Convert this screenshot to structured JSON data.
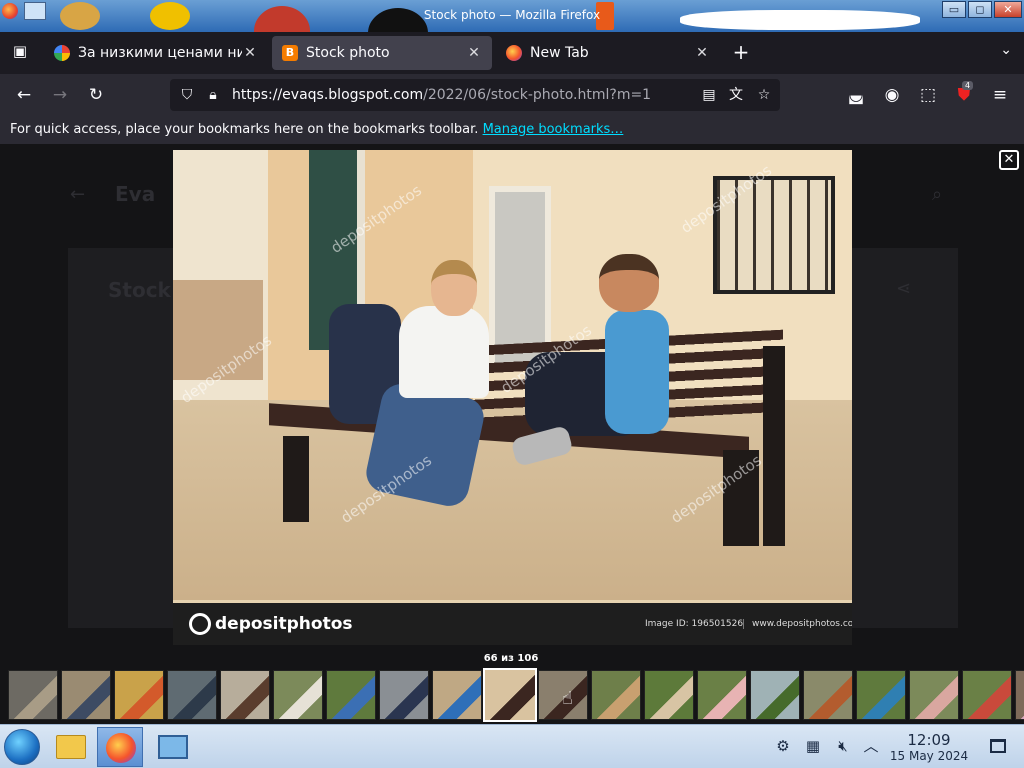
{
  "window": {
    "title": "Stock photo — Mozilla Firefox",
    "controls": {
      "minimize": "▭",
      "maximize": "◻",
      "close": "✕"
    }
  },
  "tabs": [
    {
      "title": "За низкими ценами ни",
      "favicon": "google-icon",
      "active": false
    },
    {
      "title": "Stock photo",
      "favicon": "blogger-icon",
      "active": true
    },
    {
      "title": "New Tab",
      "favicon": "firefox-icon",
      "active": false
    }
  ],
  "url": {
    "host": "https://evaqs.blogspot.com",
    "path": "/2022/06/stock-photo.html?m=1"
  },
  "toolbar": {
    "extensions_badge": "4"
  },
  "bookmarks_bar": {
    "message": "For quick access, place your bookmarks here on the bookmarks toolbar.",
    "manage_link": "Manage bookmarks…"
  },
  "lightbox": {
    "counter": "66 из 106",
    "photo": {
      "brand": "depositphotos",
      "image_id": "Image ID: 196501526",
      "site": "www.depositphotos.com"
    },
    "thumbnails": [
      {
        "color": "#6d6a63",
        "accent": "#a89c86"
      },
      {
        "color": "#9a8b72",
        "accent": "#3d4b63"
      },
      {
        "color": "#c9a24a",
        "accent": "#d35a2b"
      },
      {
        "color": "#5f6b72",
        "accent": "#2d3a4a"
      },
      {
        "color": "#b7ad9b",
        "accent": "#5a3d2d"
      },
      {
        "color": "#7c8a5a",
        "accent": "#e6e1d6"
      },
      {
        "color": "#5f7a3d",
        "accent": "#3b6fb4"
      },
      {
        "color": "#8a8f94",
        "accent": "#2a3550"
      },
      {
        "color": "#bfa884",
        "accent": "#2e6fb8"
      },
      {
        "color": "#d9c3a0",
        "accent": "#3b2620"
      },
      {
        "color": "#8a7f6d",
        "accent": "#3b2620"
      },
      {
        "color": "#6e7f4a",
        "accent": "#c9a070"
      },
      {
        "color": "#5d7a3a",
        "accent": "#d8c4a4"
      },
      {
        "color": "#6a8046",
        "accent": "#e7b3b3"
      },
      {
        "color": "#9fb2b5",
        "accent": "#466b2b"
      },
      {
        "color": "#8a8a6a",
        "accent": "#b35c2e"
      },
      {
        "color": "#5f7a3d",
        "accent": "#2f7fb2"
      },
      {
        "color": "#7c8a5a",
        "accent": "#d9a7a0"
      },
      {
        "color": "#6a8046",
        "accent": "#c94a3b"
      },
      {
        "color": "#7e6b5a",
        "accent": "#d9a7c0"
      }
    ]
  },
  "taskbar": {
    "clock_time": "12:09",
    "clock_date": "15 May 2024"
  }
}
